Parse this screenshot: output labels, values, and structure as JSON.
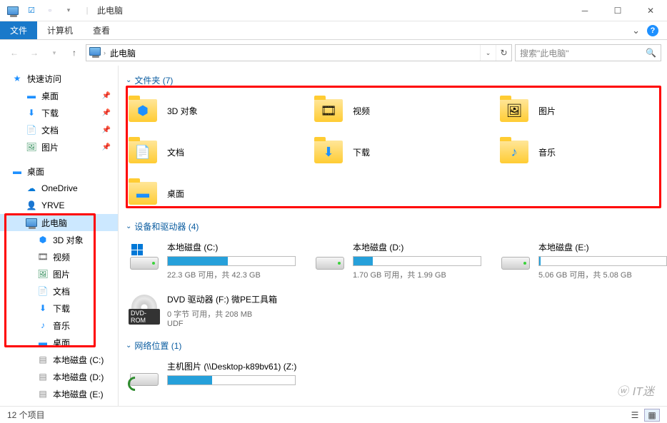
{
  "titlebar": {
    "title": "此电脑"
  },
  "ribbon": {
    "file": "文件",
    "computer": "计算机",
    "view": "查看"
  },
  "nav": {
    "crumb": "此电脑"
  },
  "search": {
    "placeholder": "搜索\"此电脑\""
  },
  "sidebar": {
    "quick": "快速访问",
    "quick_items": [
      "桌面",
      "下载",
      "文档",
      "图片"
    ],
    "desktop": "桌面",
    "desktop_items": [
      "OneDrive",
      "YRVE",
      "此电脑"
    ],
    "pc_items": [
      "3D 对象",
      "视频",
      "图片",
      "文档",
      "下载",
      "音乐",
      "桌面"
    ],
    "drives": [
      "本地磁盘 (C:)",
      "本地磁盘 (D:)",
      "本地磁盘 (E:)"
    ]
  },
  "groups": {
    "folders": {
      "label": "文件夹 (7)"
    },
    "devices": {
      "label": "设备和驱动器 (4)"
    },
    "network": {
      "label": "网络位置 (1)"
    }
  },
  "folders": [
    {
      "name": "3D 对象"
    },
    {
      "name": "视频"
    },
    {
      "name": "图片"
    },
    {
      "name": "文档"
    },
    {
      "name": "下载"
    },
    {
      "name": "音乐"
    },
    {
      "name": "桌面"
    }
  ],
  "drives": [
    {
      "name": "本地磁盘 (C:)",
      "stat": "22.3 GB 可用，共 42.3 GB",
      "pct": 47
    },
    {
      "name": "本地磁盘 (D:)",
      "stat": "1.70 GB 可用，共 1.99 GB",
      "pct": 15
    },
    {
      "name": "本地磁盘 (E:)",
      "stat": "5.06 GB 可用，共 5.08 GB",
      "pct": 1
    }
  ],
  "dvd": {
    "name": "DVD 驱动器 (F:) 微PE工具箱",
    "stat": "0 字节 可用，共 208 MB",
    "fs": "UDF",
    "badge": "DVD-ROM"
  },
  "network": {
    "name": "主机图片 (\\\\Desktop-k89bv61) (Z:)",
    "pct": 35
  },
  "status": {
    "count": "12 个项目"
  },
  "watermark": "IT迷"
}
